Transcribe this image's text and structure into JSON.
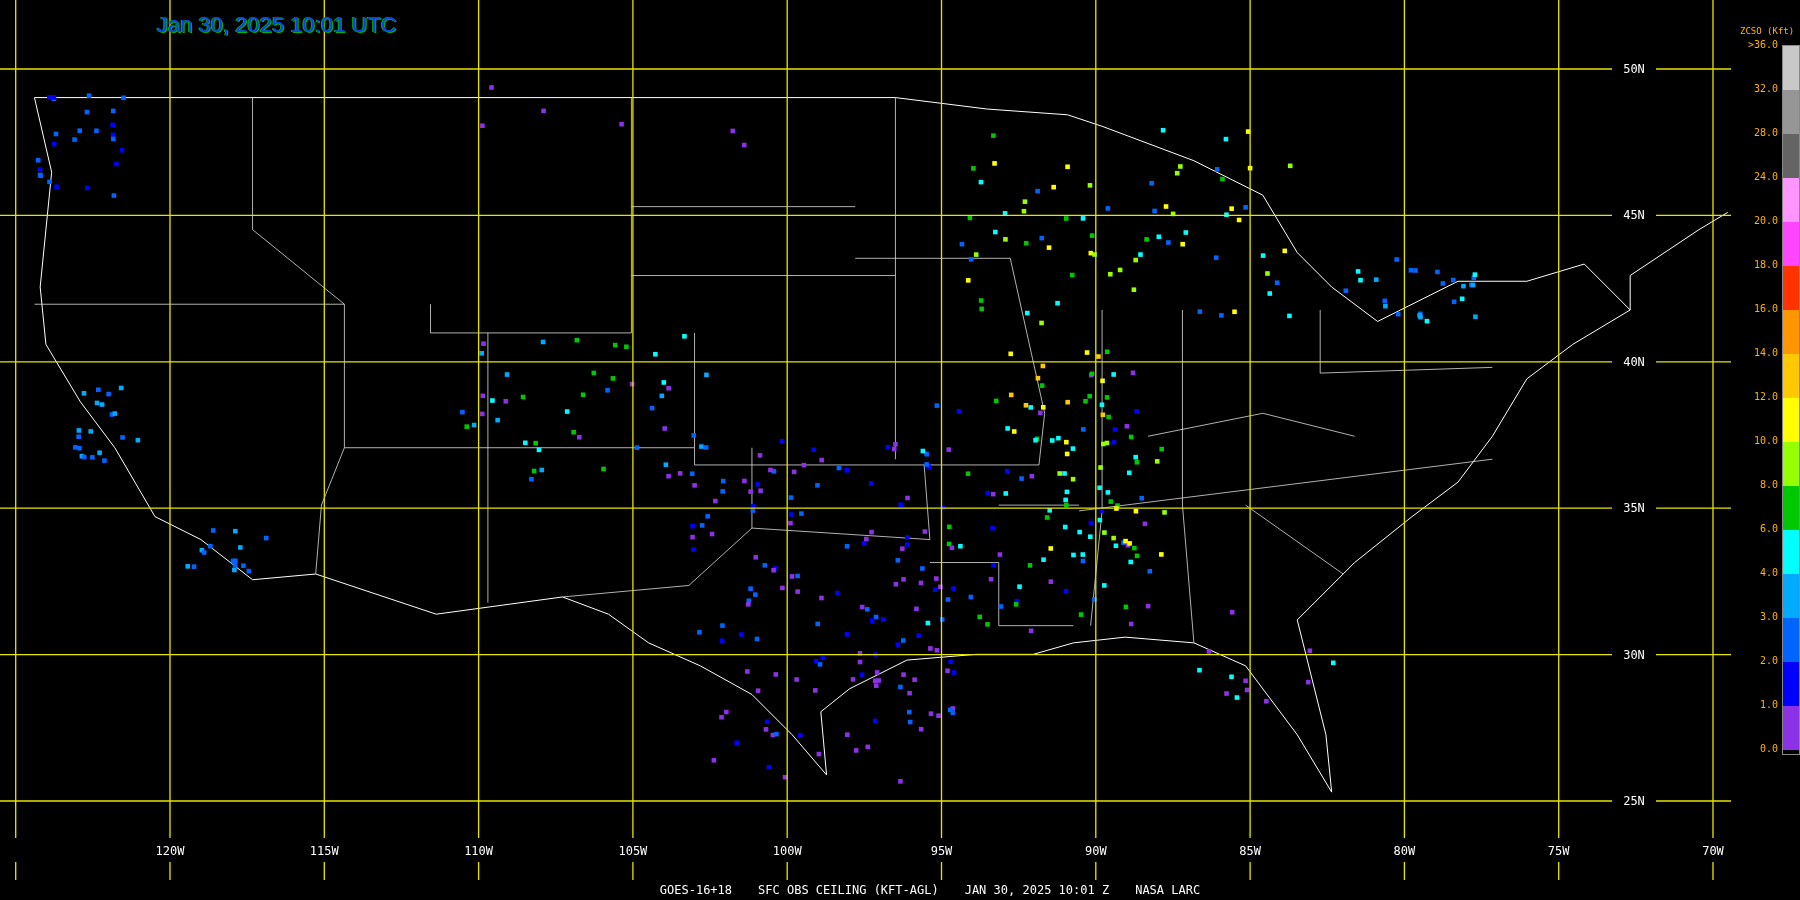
{
  "title": "Jan 30, 2025 10:01 UTC",
  "latitude_labels": [
    "50N",
    "45N",
    "40N",
    "35N",
    "30N",
    "25N"
  ],
  "longitude_labels": [
    "120W",
    "115W",
    "110W",
    "105W",
    "100W",
    "95W",
    "90W",
    "85W",
    "80W",
    "75W",
    "70W"
  ],
  "legend": {
    "title": "ZCSO (Kft)",
    "labels": [
      ">36.0",
      "32.0",
      "28.0",
      "24.0",
      "20.0",
      "18.0",
      "16.0",
      "14.0",
      "12.0",
      "10.0",
      "8.0",
      "6.0",
      "4.0",
      "3.0",
      "2.0",
      "1.0",
      "0.0"
    ],
    "segments": [
      {
        "color": "#c8c8c8"
      },
      {
        "color": "#969696"
      },
      {
        "color": "#646464"
      },
      {
        "color": "#ff96ff"
      },
      {
        "color": "#ff46ff"
      },
      {
        "color": "#ff3200"
      },
      {
        "color": "#ff9600"
      },
      {
        "color": "#ffc800"
      },
      {
        "color": "#ffff00"
      },
      {
        "color": "#96ff00"
      },
      {
        "color": "#00c800"
      },
      {
        "color": "#00ffff"
      },
      {
        "color": "#00aaff"
      },
      {
        "color": "#0064ff"
      },
      {
        "color": "#0000ff"
      },
      {
        "color": "#8c32e6"
      }
    ]
  },
  "caption": [
    "GOES-16+18",
    "SFC OBS CEILING (KFT-AGL)",
    "JAN 30, 2025 10:01 Z",
    "NASA LARC"
  ]
}
